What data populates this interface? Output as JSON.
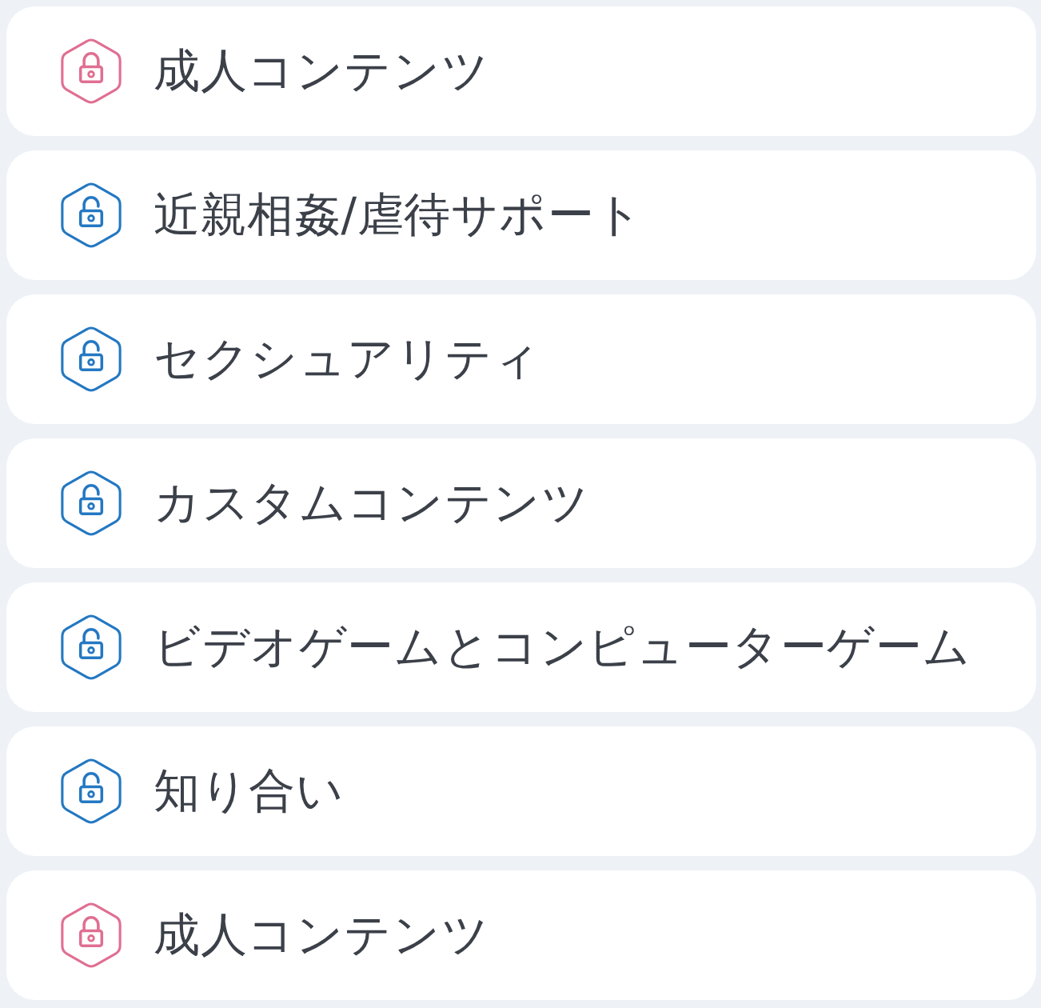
{
  "items": [
    {
      "label": "成人コンテンツ",
      "locked": true
    },
    {
      "label": "近親相姦/虐待サポート",
      "locked": false
    },
    {
      "label": "セクシュアリティ",
      "locked": false
    },
    {
      "label": "カスタムコンテンツ",
      "locked": false
    },
    {
      "label": "ビデオゲームとコンピューターゲーム",
      "locked": false
    },
    {
      "label": "知り合い",
      "locked": false
    },
    {
      "label": "成人コンテンツ",
      "locked": true
    }
  ]
}
